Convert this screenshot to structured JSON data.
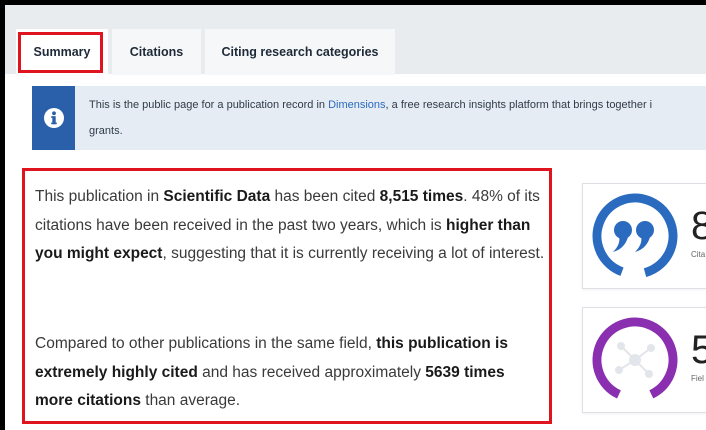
{
  "tabs": {
    "summary": "Summary",
    "citations": "Citations",
    "categories": "Citing research categories"
  },
  "info": {
    "text_before_link": "This is the public page for a publication record in ",
    "link_text": "Dimensions",
    "text_after_link": ", a free research insights platform that brings together i",
    "second_line": "grants."
  },
  "summary": {
    "p1_t1": "This publication in ",
    "journal": "Scientific Data",
    "p1_t2": " has been cited ",
    "cited_count": "8,515 times",
    "p1_t3": ". 48% of its citations have been received in the past two years, which is ",
    "expectation": "higher than you might expect",
    "p1_t4": ", suggesting that it is currently receiving a lot of interest.",
    "p2_t1": "Compared to other publications in the same field, ",
    "field_status": "this publication is extremely highly cited",
    "p2_t2": " and has received approximately ",
    "times_more": "5639 times more citations",
    "p2_t3": " than average."
  },
  "metrics": {
    "citations_number": "8",
    "citations_label": "Cita",
    "field_number": "5",
    "field_label": "Fiel"
  },
  "colors": {
    "highlight": "#e0141e",
    "info_accent": "#2a5faa",
    "citations_ring": "#2a6bbf",
    "field_ring": "#8a2fb0"
  },
  "icons": {
    "info": "info-circle-icon",
    "citations": "quote-icon",
    "field": "network-icon"
  }
}
